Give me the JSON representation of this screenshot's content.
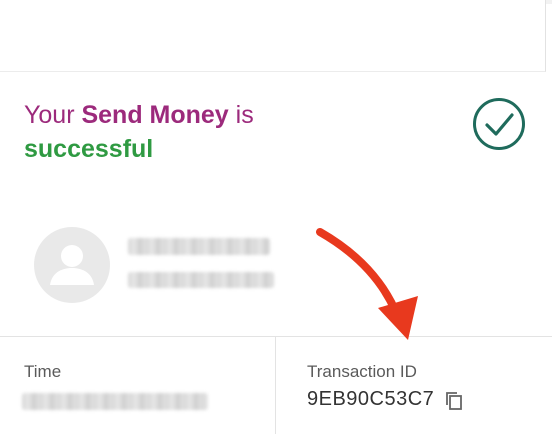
{
  "status": {
    "prefix": "Your ",
    "service": "Send Money",
    "suffix": " is",
    "result": "successful"
  },
  "recipient": {
    "name": "",
    "number": ""
  },
  "details": {
    "time_label": "Time",
    "time_value": "",
    "txn_label": "Transaction ID",
    "txn_value": "9EB90C53C7"
  },
  "icons": {
    "status": "check-circle-icon",
    "avatar": "person-avatar-icon",
    "copy": "copy-icon",
    "annotation": "red-arrow"
  },
  "colors": {
    "service_text": "#9c2a7c",
    "success_text": "#2f9a42",
    "check_icon": "#1f6b5c",
    "arrow": "#e8391e"
  }
}
